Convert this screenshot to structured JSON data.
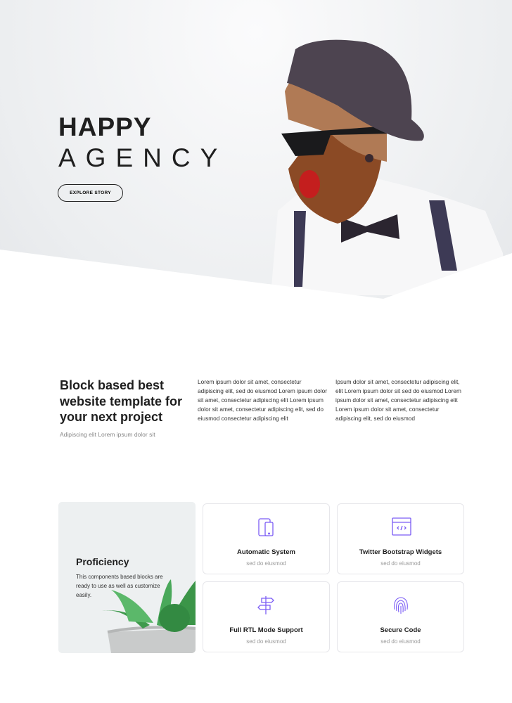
{
  "hero": {
    "title_line1": "HAPPY",
    "title_line2": "AGENCY",
    "button": "EXPLORE STORY"
  },
  "intro": {
    "title": "Block based best website template for your next project",
    "subtitle": "Adipiscing elit Lorem ipsum dolor sit",
    "col1": "Lorem ipsum dolor sit amet, consectetur adipiscing elit, sed do eiusmod Lorem ipsum dolor sit amet, consectetur adipiscing elit Lorem ipsum dolor sit amet, consectetur adipiscing elit, sed do eiusmod consectetur adipiscing elit",
    "col2": "Ipsum dolor sit amet, consectetur adipiscing elit, elit Lorem ipsum dolor sit sed do eiusmod Lorem ipsum dolor sit amet, consectetur adipiscing elit Lorem ipsum dolor sit amet, consectetur adipiscing elit, sed do eiusmod"
  },
  "proficiency": {
    "title": "Proficiency",
    "text": "This components based blocks are ready to use as well as customize easily."
  },
  "features": [
    {
      "title": "Automatic System",
      "sub": "sed do eiusmod",
      "icon": "devices-icon"
    },
    {
      "title": "Twitter Bootstrap Widgets",
      "sub": "sed do eiusmod",
      "icon": "code-window-icon"
    },
    {
      "title": "Full RTL Mode Support",
      "sub": "sed do eiusmod",
      "icon": "signpost-icon"
    },
    {
      "title": "Secure Code",
      "sub": "sed do eiusmod",
      "icon": "fingerprint-icon"
    }
  ],
  "colors": {
    "accent": "#7b5cf5"
  }
}
